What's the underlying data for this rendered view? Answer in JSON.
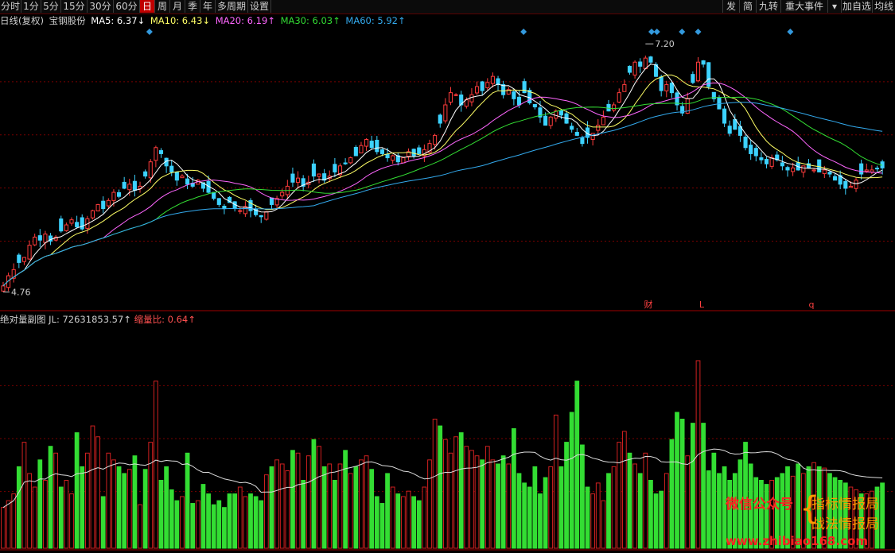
{
  "toolbar": {
    "periods": [
      {
        "label": "分时",
        "name": "period-fenshi"
      },
      {
        "label": "1分",
        "name": "period-1min"
      },
      {
        "label": "5分",
        "name": "period-5min"
      },
      {
        "label": "15分",
        "name": "period-15min"
      },
      {
        "label": "30分",
        "name": "period-30min"
      },
      {
        "label": "60分",
        "name": "period-60min"
      },
      {
        "label": "日",
        "name": "period-day",
        "active": true
      },
      {
        "label": "周",
        "name": "period-week"
      },
      {
        "label": "月",
        "name": "period-month"
      },
      {
        "label": "季",
        "name": "period-quarter"
      },
      {
        "label": "年",
        "name": "period-year"
      },
      {
        "label": "多周期",
        "name": "period-multi"
      },
      {
        "label": "设置",
        "name": "settings"
      }
    ],
    "right_buttons": [
      "发",
      "简",
      "九转",
      "重大事件",
      "▾",
      "加自选",
      "均线"
    ]
  },
  "legend": {
    "title": "日线(复权)",
    "stock": "宝钢股份",
    "ma5": "MA5: 6.37↓",
    "ma10": "MA10: 6.43↓",
    "ma20": "MA20: 6.19↑",
    "ma30": "MA30: 6.03↑",
    "ma60": "MA60: 5.92↑"
  },
  "volume_legend": {
    "title": "绝对量副图",
    "jl": "JL: 72631853.57↑",
    "ratio": "缩量比: 0.64↑"
  },
  "annotations": {
    "high_label": "7.20",
    "low_label": "4.76",
    "markers": [
      "财",
      "L",
      "q"
    ]
  },
  "watermark": {
    "line1": "微信公众号",
    "line2": "指标情报局",
    "line3": "战法情报局",
    "line4": "www.zhibiao168.com"
  },
  "colors": {
    "up": "#ff3c3c",
    "down": "#3cd2ff",
    "ma5": "#ffffff",
    "ma10": "#ffff66",
    "ma20": "#ff66ff",
    "ma30": "#33dd33",
    "ma60": "#33aaee",
    "vol_up": "#d02020",
    "vol_down": "#33dd33",
    "grid": "#7a0000"
  },
  "chart_data": {
    "type": "candlestick",
    "ylim": [
      4.6,
      7.35
    ],
    "high": 7.2,
    "low": 4.76,
    "closes": [
      4.82,
      4.92,
      4.98,
      5.05,
      5.1,
      5.22,
      5.3,
      5.27,
      5.33,
      5.26,
      5.3,
      5.36,
      5.42,
      5.47,
      5.4,
      5.38,
      5.48,
      5.56,
      5.62,
      5.58,
      5.66,
      5.74,
      5.7,
      5.78,
      5.82,
      5.76,
      5.8,
      5.9,
      6.04,
      6.18,
      6.12,
      6.0,
      5.94,
      5.86,
      5.9,
      5.82,
      5.8,
      5.86,
      5.78,
      5.74,
      5.68,
      5.62,
      5.58,
      5.64,
      5.58,
      5.56,
      5.6,
      5.56,
      5.52,
      5.5,
      5.55,
      5.62,
      5.68,
      5.74,
      5.8,
      5.84,
      5.88,
      5.8,
      5.84,
      5.9,
      5.92,
      5.86,
      5.9,
      5.94,
      6.0,
      6.02,
      6.08,
      6.1,
      6.2,
      6.26,
      6.18,
      6.14,
      6.12,
      6.08,
      6.1,
      6.04,
      6.08,
      6.14,
      6.1,
      6.12,
      6.16,
      6.22,
      6.3,
      6.42,
      6.6,
      6.72,
      6.7,
      6.6,
      6.65,
      6.7,
      6.78,
      6.74,
      6.82,
      6.88,
      6.8,
      6.7,
      6.75,
      6.66,
      6.6,
      6.72,
      6.62,
      6.58,
      6.48,
      6.4,
      6.48,
      6.54,
      6.5,
      6.42,
      6.36,
      6.3,
      6.22,
      6.28,
      6.32,
      6.4,
      6.48,
      6.54,
      6.6,
      6.72,
      6.8,
      6.92,
      7.02,
      6.98,
      7.06,
      7.02,
      6.88,
      6.74,
      6.8,
      6.72,
      6.6,
      6.52,
      6.66,
      6.82,
      7.02,
      7.0,
      6.78,
      6.66,
      6.56,
      6.42,
      6.32,
      6.36,
      6.3,
      6.18,
      6.12,
      6.1,
      6.06,
      6.02,
      6.08,
      6.06,
      6.0,
      5.96,
      5.98,
      5.96,
      6.0,
      5.98,
      5.96,
      5.94,
      5.96,
      5.92,
      5.86,
      5.82,
      5.78,
      5.8,
      5.86,
      5.92,
      5.96,
      5.96,
      5.97,
      5.98
    ],
    "volumes": [
      30,
      35,
      40,
      60,
      78,
      55,
      45,
      65,
      50,
      75,
      70,
      45,
      50,
      40,
      85,
      60,
      70,
      90,
      82,
      38,
      70,
      65,
      60,
      55,
      58,
      68,
      32,
      58,
      78,
      123,
      50,
      60,
      43,
      35,
      38,
      70,
      33,
      35,
      47,
      40,
      32,
      35,
      30,
      40,
      40,
      45,
      38,
      40,
      38,
      35,
      54,
      60,
      65,
      62,
      57,
      72,
      70,
      50,
      68,
      80,
      75,
      60,
      62,
      50,
      62,
      72,
      55,
      60,
      65,
      68,
      58,
      38,
      33,
      55,
      45,
      40,
      38,
      42,
      38,
      35,
      45,
      65,
      95,
      90,
      80,
      70,
      82,
      85,
      75,
      72,
      68,
      65,
      75,
      65,
      62,
      68,
      62,
      88,
      55,
      48,
      45,
      60,
      40,
      52,
      60,
      98,
      60,
      78,
      100,
      123,
      76,
      45,
      40,
      48,
      35,
      55,
      60,
      78,
      86,
      70,
      62,
      55,
      70,
      50,
      40,
      42,
      55,
      80,
      100,
      95,
      68,
      92,
      138,
      92,
      57,
      70,
      55,
      60,
      50,
      55,
      65,
      78,
      62,
      52,
      50,
      47,
      50,
      52,
      55,
      60,
      53,
      62,
      55,
      60,
      63,
      60,
      59,
      55,
      52,
      50,
      48,
      45,
      43,
      40,
      40,
      42,
      45,
      48,
      50,
      52,
      55
    ],
    "ma_names": [
      "MA5",
      "MA10",
      "MA20",
      "MA30",
      "MA60"
    ]
  }
}
